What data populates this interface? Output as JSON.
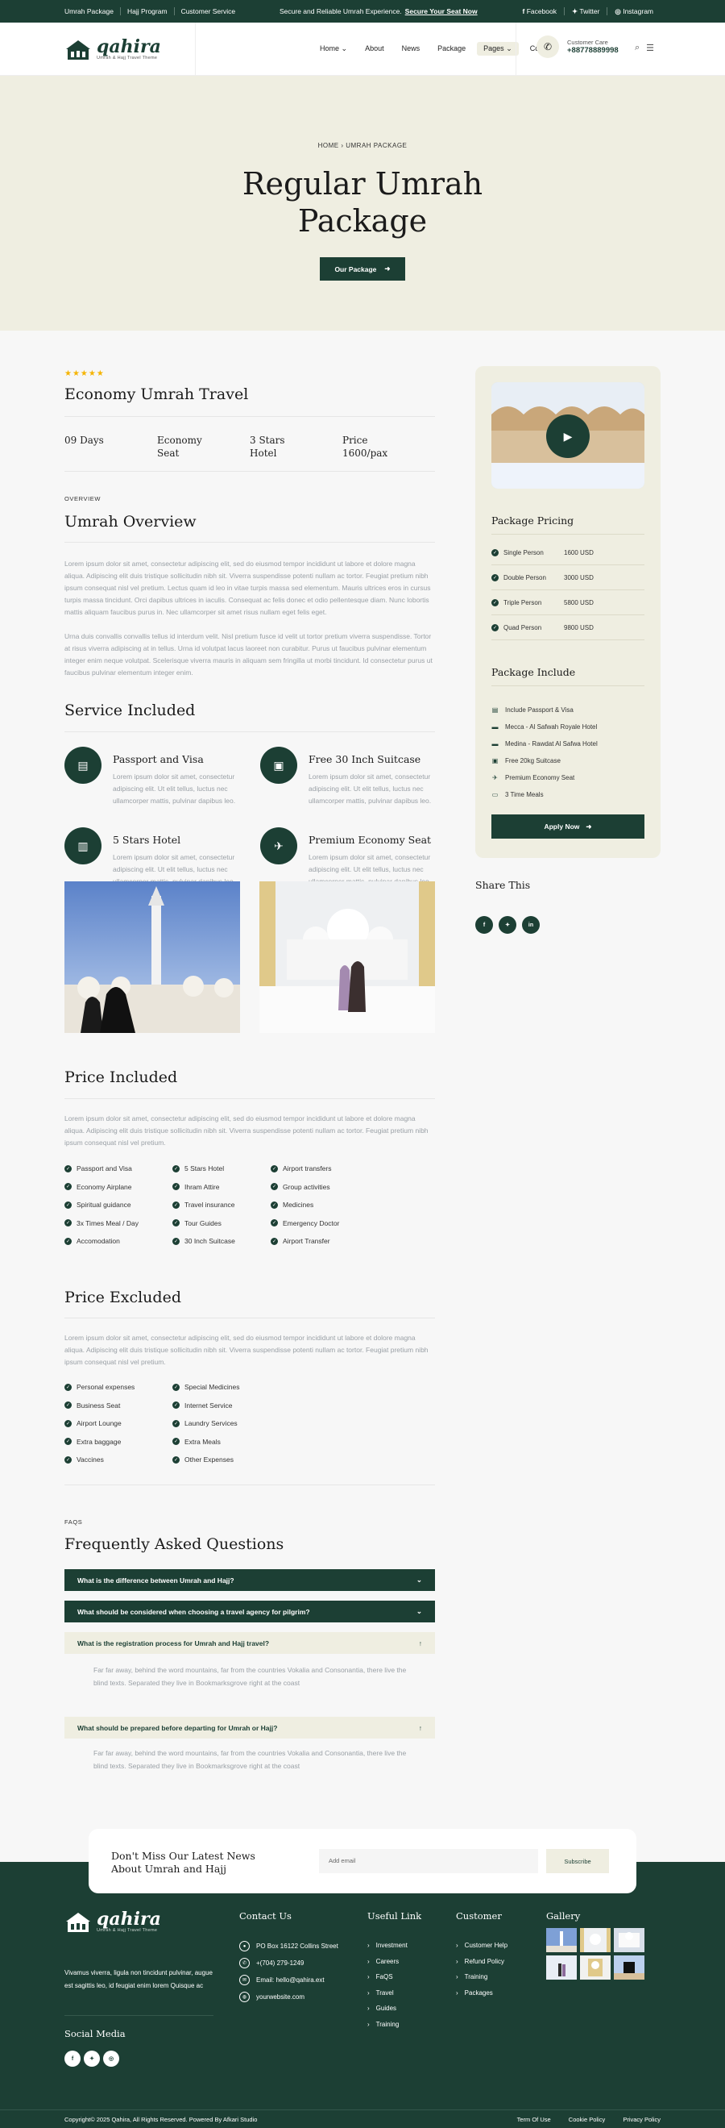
{
  "topbar": {
    "links": [
      "Umrah Package",
      "Hajj Program",
      "Customer Service"
    ],
    "promo_text": "Secure and Reliable Umrah Experience.",
    "promo_link": "Secure Your Seat Now",
    "social": [
      {
        "icon": "facebook-icon",
        "label": "Facebook"
      },
      {
        "icon": "twitter-icon",
        "label": "Twitter"
      },
      {
        "icon": "instagram-icon",
        "label": "Instagram"
      }
    ]
  },
  "header": {
    "logo_name": "qahira",
    "logo_tagline": "Umrah & Hajj Travel Theme",
    "nav": [
      "Home",
      "About",
      "News",
      "Package",
      "Pages",
      "Contact"
    ],
    "care_label": "Customer Care",
    "care_phone": "+8877788...",
    "care_phone_full": "+88778889998"
  },
  "hero": {
    "breadcrumb": "HOME › UMRAH PACKAGE",
    "title_line1": "Regular Umrah",
    "title_line2": "Package",
    "button": "Our Package"
  },
  "package": {
    "stars": "★★★★★",
    "title": "Economy Umrah Travel",
    "meta": [
      {
        "l1": "09 Days",
        "l2": ""
      },
      {
        "l1": "Economy",
        "l2": "Seat"
      },
      {
        "l1": "3 Stars",
        "l2": "Hotel"
      },
      {
        "l1": "Price",
        "l2": "1600/pax"
      }
    ]
  },
  "overview": {
    "label": "OVERVIEW",
    "title": "Umrah Overview",
    "p1": "Lorem ipsum dolor sit amet, consectetur adipiscing elit, sed do eiusmod tempor incididunt ut labore et dolore magna aliqua. Adipiscing elit duis tristique sollicitudin nibh sit. Viverra suspendisse potenti nullam ac tortor. Feugiat pretium nibh ipsum consequat nisl vel pretium. Lectus quam id leo in vitae turpis massa sed elementum. Mauris ultrices eros in cursus turpis massa tincidunt. Orci dapibus ultrices in iaculis. Consequat ac felis donec et odio pellentesque diam. Nunc lobortis mattis aliquam faucibus purus in. Nec ullamcorper sit amet risus nullam eget felis eget.",
    "p2": "Urna duis convallis convallis tellus id interdum velit. Nisl pretium fusce id velit ut tortor pretium viverra suspendisse. Tortor at risus viverra adipiscing at in tellus. Urna id volutpat lacus laoreet non curabitur. Purus ut faucibus pulvinar elementum integer enim neque volutpat. Scelerisque viverra mauris in aliquam sem fringilla ut morbi tincidunt. Id consectetur purus ut faucibus pulvinar elementum integer enim."
  },
  "services": {
    "title": "Service Included",
    "items": [
      {
        "icon": "passport-icon",
        "title": "Passport and Visa",
        "desc": "Lorem ipsum dolor sit amet, consectetur adipiscing elit. Ut elit tellus, luctus nec ullamcorper mattis, pulvinar dapibus leo."
      },
      {
        "icon": "suitcase-icon",
        "title": "Free 30 Inch Suitcase",
        "desc": "Lorem ipsum dolor sit amet, consectetur adipiscing elit. Ut elit tellus, luctus nec ullamcorper mattis, pulvinar dapibus leo."
      },
      {
        "icon": "hotel-icon",
        "title": "5 Stars Hotel",
        "desc": "Lorem ipsum dolor sit amet, consectetur adipiscing elit. Ut elit tellus, luctus nec ullamcorper mattis, pulvinar dapibus leo."
      },
      {
        "icon": "airplane-icon",
        "title": "Premium Economy Seat",
        "desc": "Lorem ipsum dolor sit amet, consectetur adipiscing elit. Ut elit tellus, luctus nec ullamcorper mattis, pulvinar dapibus leo."
      }
    ]
  },
  "price_included": {
    "title": "Price Included",
    "desc": "Lorem ipsum dolor sit amet, consectetur adipiscing elit, sed do eiusmod tempor incididunt ut labore et dolore magna aliqua. Adipiscing elit duis tristique sollicitudin nibh sit. Viverra suspendisse potenti nullam ac tortor. Feugiat pretium nibh ipsum consequat nisl vel pretium.",
    "col1": [
      "Passport and Visa",
      "Economy Airplane",
      "Spiritual guidance",
      "3x Times Meal / Day",
      "Accomodation"
    ],
    "col2": [
      "5 Stars Hotel",
      "Ihram Attire",
      "Travel insurance",
      "Tour Guides",
      "30 Inch Suitcase"
    ],
    "col3": [
      "Airport transfers",
      "Group activities",
      "Medicines",
      "Emergency Doctor",
      "Airport Transfer"
    ]
  },
  "price_excluded": {
    "title": "Price Excluded",
    "desc": "Lorem ipsum dolor sit amet, consectetur adipiscing elit, sed do eiusmod tempor incididunt ut labore et dolore magna aliqua. Adipiscing elit duis tristique sollicitudin nibh sit. Viverra suspendisse potenti nullam ac tortor. Feugiat pretium nibh ipsum consequat nisl vel pretium.",
    "col1": [
      "Personal expenses",
      "Business Seat",
      "Airport Lounge",
      "Extra baggage",
      "Vaccines"
    ],
    "col2": [
      "Special Medicines",
      "Internet Service",
      "Laundry Services",
      "Extra Meals",
      "Other Expenses"
    ]
  },
  "faq": {
    "label": "FAQS",
    "title": "Frequently Asked Questions",
    "items": [
      {
        "q": "What is the difference between Umrah and Hajj?",
        "a": ""
      },
      {
        "q": "What should be considered when choosing a travel agency for pilgrim?",
        "a": ""
      },
      {
        "q": "What is the registration process for Umrah and Hajj travel?",
        "a": "Far far away, behind the word mountains, far from the countries Vokalia and Consonantia, there live the blind texts. Separated they live in Bookmarksgrove right at the coast"
      },
      {
        "q": "What should be prepared before departing for Umrah or Hajj?",
        "a": "Far far away, behind the word mountains, far from the countries Vokalia and Consonantia, there live the blind texts. Separated they live in Bookmarksgrove right at the coast"
      }
    ]
  },
  "sidebar": {
    "pricing_title": "Package Pricing",
    "pricing": [
      {
        "name": "Single Person",
        "price": "1600 USD"
      },
      {
        "name": "Double Person",
        "price": "3000 USD"
      },
      {
        "name": "Triple Person",
        "price": "5800 USD"
      },
      {
        "name": "Quad Person",
        "price": "9800 USD"
      }
    ],
    "include_title": "Package Include",
    "includes": [
      {
        "icon": "passport-icon",
        "label": "Include Passport & Visa"
      },
      {
        "icon": "bed-icon",
        "label": "Mecca - Al Safwah Royale Hotel"
      },
      {
        "icon": "bed-icon",
        "label": "Medina - Rawdat Al Safwa Hotel"
      },
      {
        "icon": "suitcase-icon",
        "label": "Free 20kg Suitcase"
      },
      {
        "icon": "plane-icon",
        "label": "Premium Economy Seat"
      },
      {
        "icon": "meal-icon",
        "label": "3 Time Meals"
      }
    ],
    "apply_button": "Apply Now",
    "share_title": "Share This"
  },
  "newsletter": {
    "title_line1": "Don't Miss Our Latest News",
    "title_line2": "About Umrah and Hajj",
    "placeholder": "Add email",
    "button": "Subscribe"
  },
  "footer": {
    "logo_name": "qahira",
    "logo_tagline": "Umrah & Hajj Travel Theme",
    "desc": "Vivamus viverra, ligula non tincidunt pulvinar, augue est sagittis leo, id feugiat enim lorem Quisque ac",
    "social_title": "Social Media",
    "contact_title": "Contact Us",
    "contacts": [
      "PO Box 16122 Collins Street",
      "+(704) 279-1249",
      "Email: hello@qahira.ext",
      "yourwebsite.com"
    ],
    "useful_title": "Useful Link",
    "useful": [
      "Investment",
      "Careers",
      "FaQS",
      "Travel",
      "Guides",
      "Training"
    ],
    "customer_title": "Customer",
    "customer": [
      "Customer Help",
      "Refund Policy",
      "Training",
      "Packages"
    ],
    "gallery_title": "Gallery",
    "copyright": "Copyright© 2025 Qahira, All Rights Reserved. Powered By Afkari Studio",
    "bottom_links": [
      "Term Of Use",
      "Cookie Policy",
      "Privacy Policy"
    ]
  },
  "colors": {
    "primary": "#1c3f34",
    "beige": "#efeee1",
    "star": "#f5b400"
  }
}
